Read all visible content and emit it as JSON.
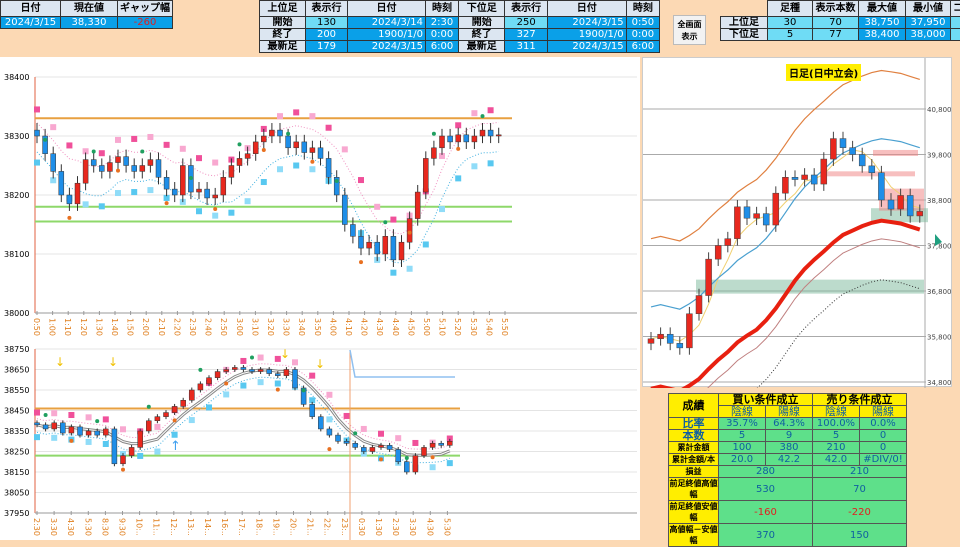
{
  "top_left": {
    "headers": [
      "日付",
      "現在値",
      "ギャップ幅"
    ],
    "values": [
      "2024/3/15",
      "38,330",
      "-260"
    ]
  },
  "upper_tf": {
    "headers": [
      "上位足",
      "表示行",
      "日付",
      "時刻"
    ],
    "rows": [
      [
        "開始",
        "130",
        "2024/3/14",
        "2:30"
      ],
      [
        "終了",
        "200",
        "1900/1/0",
        "0:00"
      ],
      [
        "最新足",
        "179",
        "2024/3/15",
        "6:00"
      ]
    ]
  },
  "lower_tf": {
    "headers": [
      "下位足",
      "表示行",
      "日付",
      "時刻"
    ],
    "rows": [
      [
        "開始",
        "250",
        "2024/3/15",
        "0:50"
      ],
      [
        "終了",
        "327",
        "1900/1/0",
        "0:00"
      ],
      [
        "最新足",
        "311",
        "2024/3/15",
        "6:00"
      ]
    ]
  },
  "fullscreen_button": {
    "line1": "全画面",
    "line2": "表示"
  },
  "settings": {
    "headers": [
      "",
      "足種",
      "表示本数",
      "最大値",
      "最小値",
      "コマ"
    ],
    "rows": [
      [
        "上位足",
        "30",
        "70",
        "38,750",
        "37,950"
      ],
      [
        "下位足",
        "5",
        "77",
        "38,400",
        "38,000"
      ]
    ]
  },
  "results": {
    "title": "成績",
    "buy": "買い条件成立",
    "sell": "売り条件成立",
    "yin": "陰線",
    "yang": "陽線",
    "rows": [
      {
        "label": "比率",
        "v": [
          "35.7%",
          "64.3%",
          "100.0%",
          "0.0%"
        ]
      },
      {
        "label": "本数",
        "v": [
          "5",
          "9",
          "5",
          "0"
        ]
      },
      {
        "label": "累計金額",
        "v": [
          "100",
          "380",
          "210",
          "0"
        ]
      },
      {
        "label": "累計金額/本",
        "v": [
          "20.0",
          "42.2",
          "42.0",
          "#DIV/0!"
        ]
      }
    ],
    "rows2": [
      {
        "label": "損益",
        "v": [
          "280",
          "210"
        ]
      },
      {
        "label": "前足終値高値幅",
        "v": [
          "530",
          "70"
        ]
      },
      {
        "label": "前足終値安値幅",
        "v": [
          "-160",
          "-220"
        ]
      },
      {
        "label": "高値幅－安値幅",
        "v": [
          "370",
          "150"
        ]
      }
    ]
  },
  "colors": {
    "up": "#e8281e",
    "down": "#1e8ee8",
    "pink_band": "#f0509a",
    "light_band": "#58c8f0",
    "green_line": "#8ed86a",
    "orange_line": "#e8a040"
  },
  "chart_data": [
    {
      "type": "candlestick",
      "name": "lower-timeframe-5min",
      "ylim": [
        38000,
        38400
      ],
      "yticks": [
        "38400",
        "38300",
        "38200",
        "38100",
        "38000"
      ],
      "xticks": [
        "0:50",
        "1:00",
        "1:10",
        "1:20",
        "1:30",
        "1:40",
        "1:50",
        "2:00",
        "2:10",
        "2:20",
        "2:30",
        "2:40",
        "2:50",
        "3:00",
        "3:10",
        "3:20",
        "3:30",
        "3:40",
        "3:50",
        "4:00",
        "4:10",
        "4:20",
        "4:30",
        "4:40",
        "4:50",
        "5:00",
        "5:10",
        "5:20",
        "5:30",
        "5:40",
        "5:50"
      ],
      "closes": [
        38300,
        38270,
        38240,
        38200,
        38185,
        38220,
        38260,
        38250,
        38240,
        38255,
        38265,
        38250,
        38240,
        38250,
        38260,
        38230,
        38210,
        38200,
        38250,
        38205,
        38210,
        38195,
        38200,
        38230,
        38250,
        38262,
        38270,
        38290,
        38300,
        38310,
        38300,
        38280,
        38290,
        38272,
        38280,
        38262,
        38230,
        38200,
        38150,
        38130,
        38110,
        38120,
        38100,
        38130,
        38090,
        38120,
        38160,
        38205,
        38262,
        38280,
        38300,
        38290,
        38302,
        38290,
        38300,
        38310,
        38300,
        38302
      ],
      "hlines": [
        38330,
        38180,
        38155
      ]
    },
    {
      "type": "candlestick",
      "name": "upper-timeframe-30min",
      "ylim": [
        37950,
        38750
      ],
      "yticks": [
        "38750",
        "38650",
        "38550",
        "38450",
        "38350",
        "38250",
        "38150",
        "38050",
        "37950"
      ],
      "xticks": [
        "2:30",
        "3:30",
        "4:30",
        "5:30",
        "8:30",
        "9:30",
        "10:..",
        "11:..",
        "12:..",
        "13:..",
        "14:..",
        "16:..",
        "17:..",
        "18:..",
        "19:..",
        "20:..",
        "21:..",
        "22:..",
        "23:..",
        "0:30",
        "1:30",
        "2:30",
        "3:30",
        "4:30",
        "5:30"
      ],
      "closes": [
        38380,
        38360,
        38390,
        38340,
        38370,
        38330,
        38350,
        38330,
        38360,
        38190,
        38230,
        38270,
        38350,
        38400,
        38420,
        38440,
        38470,
        38500,
        38550,
        38580,
        38610,
        38640,
        38650,
        38660,
        38650,
        38640,
        38650,
        38630,
        38620,
        38650,
        38560,
        38480,
        38420,
        38360,
        38330,
        38300,
        38290,
        38270,
        38250,
        38270,
        38280,
        38260,
        38200,
        38150,
        38230,
        38270,
        38290,
        38280,
        38300
      ],
      "hlines": [
        38460,
        38230
      ]
    },
    {
      "type": "candlestick",
      "name": "daily-day-session",
      "title": "日足(日中立会)",
      "ylim": [
        34800,
        41300
      ],
      "yticks": [
        "40,800",
        "39,800",
        "38,800",
        "37,800",
        "36,800",
        "35,800",
        "34,800"
      ],
      "closes": [
        35750,
        35850,
        35650,
        35550,
        36300,
        36700,
        37500,
        37800,
        37950,
        38650,
        38400,
        38500,
        38250,
        38950,
        39300,
        39250,
        39350,
        39150,
        39700,
        40150,
        39950,
        39800,
        39550,
        39400,
        38800,
        38600,
        38900,
        38450,
        38550
      ]
    }
  ]
}
